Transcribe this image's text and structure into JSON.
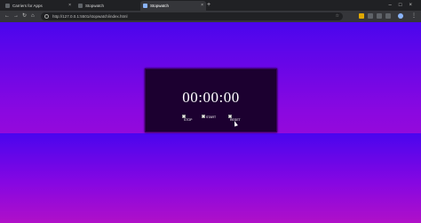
{
  "browser": {
    "tabs": [
      {
        "title": "Carriers for Apps",
        "active": false
      },
      {
        "title": "Stopwatch",
        "active": false
      },
      {
        "title": "Stopwatch",
        "active": true
      }
    ],
    "url": "http://127.0.0.1:5501/stopwatch/index.html"
  },
  "stopwatch": {
    "time": "00:00:00",
    "buttons": {
      "stop": "STOP",
      "start": "START",
      "reset": "RESET"
    }
  },
  "colors": {
    "gradient_top": "#4a05ee",
    "gradient_bottom": "#b810c8",
    "panel": "#1c0030"
  }
}
